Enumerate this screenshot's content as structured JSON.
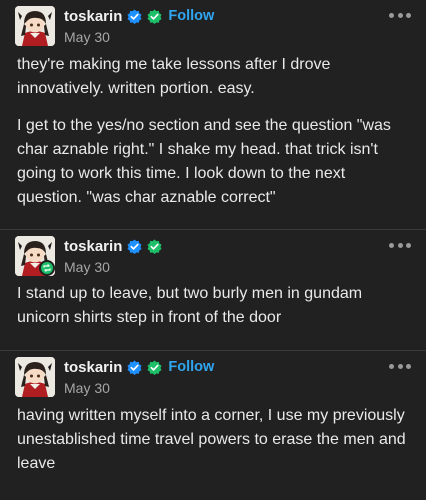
{
  "posts": [
    {
      "username": "toskarin",
      "follow_label": "Follow",
      "date": "May 30",
      "paragraphs": [
        "they're making me take lessons after I drove innovatively. written portion. easy.",
        "I get to the yes/no section and see the question \"was char aznable right.\" I shake my head. that trick isn't going to work this time. I look down to the next question. \"was char aznable correct\""
      ]
    },
    {
      "username": "toskarin",
      "date": "May 30",
      "paragraphs": [
        "I stand up to leave, but two burly men in gundam unicorn shirts step in front of the door"
      ]
    },
    {
      "username": "toskarin",
      "follow_label": "Follow",
      "date": "May 30",
      "paragraphs": [
        "having written myself into a corner, I use my previously unestablished time travel powers to erase the men and leave"
      ]
    }
  ],
  "colors": {
    "background": "#212121",
    "text": "#e9e9e9",
    "follow": "#2fa6f1",
    "verified_blue": "#1e90ff",
    "verified_green": "#1dbf68",
    "divider": "#3a3a3a"
  },
  "icons": [
    "avatar",
    "verified-badge-blue",
    "verified-badge-green",
    "more-options-icon",
    "reblog-icon"
  ]
}
